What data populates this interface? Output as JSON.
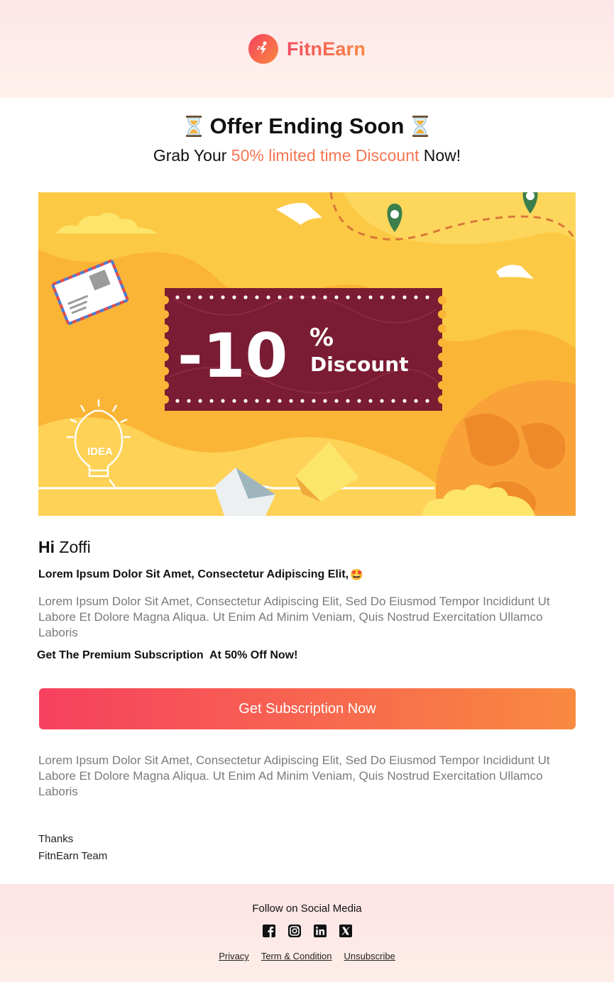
{
  "brand": {
    "name": "FitnEarn"
  },
  "offer": {
    "title": "Offer Ending Soon",
    "title_icon": "hourglass-icon",
    "subtitle_prefix": "Grab Your ",
    "subtitle_accent": "50% limited time Discount",
    "subtitle_suffix": " Now!"
  },
  "banner": {
    "discount_value": "-10",
    "discount_percent": "%",
    "discount_word": "Discount",
    "idea_label": "IDEA"
  },
  "email": {
    "greeting_hi": "Hi",
    "greeting_name": " Zoffi",
    "lead": "Lorem Ipsum Dolor Sit Amet, Consectetur Adipiscing Elit,",
    "lead_emoji": "🤩",
    "paragraph1": "Lorem Ipsum Dolor Sit Amet, Consectetur Adipiscing Elit, Sed Do Eiusmod Tempor Incididunt Ut Labore Et Dolore Magna Aliqua. Ut Enim Ad Minim Veniam, Quis Nostrud Exercitation Ullamco Laboris",
    "premium_line": "Get The Premium Subscription  At 50% Off Now!",
    "cta_label": "Get Subscription Now",
    "paragraph2": "Lorem Ipsum Dolor Sit Amet, Consectetur Adipiscing Elit, Sed Do Eiusmod Tempor Incididunt Ut Labore Et Dolore Magna Aliqua. Ut Enim Ad Minim Veniam, Quis Nostrud Exercitation Ullamco Laboris",
    "thanks": "Thanks",
    "signature": "FitnEarn Team"
  },
  "footer": {
    "follow_label": "Follow on Social Media",
    "socials": [
      "facebook-icon",
      "instagram-icon",
      "linkedin-icon",
      "x-icon"
    ],
    "links": [
      "Privacy",
      "Term & Condition",
      "Unsubscribe"
    ]
  },
  "colors": {
    "accent": "#f57552",
    "gradient_start": "#f6405f",
    "gradient_end": "#f98a40",
    "banner_bg": "#fbb536",
    "coupon": "#7a1c33"
  }
}
